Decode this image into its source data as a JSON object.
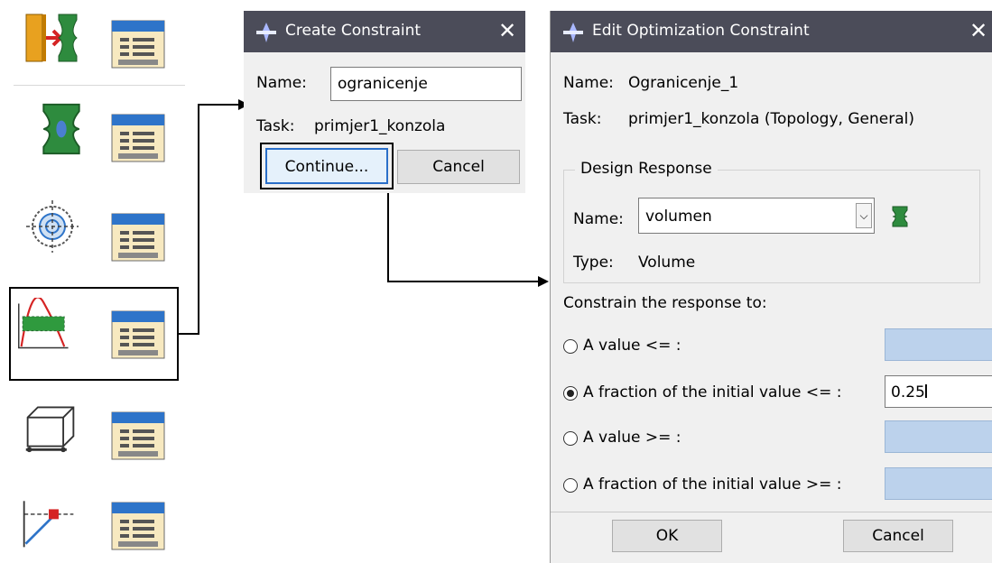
{
  "toolbox": {
    "tools": [
      {
        "name": "create-design-response"
      },
      {
        "name": "create-objective-function"
      },
      {
        "name": "create-constraint"
      },
      {
        "name": "create-geometric-restriction"
      },
      {
        "name": "create-stop-condition"
      }
    ]
  },
  "create_dialog": {
    "title": "Create Constraint",
    "close": "✕",
    "name_label": "Name:",
    "name_value": "ogranicenje",
    "task_label": "Task:",
    "task_value": "primjer1_konzola",
    "continue_label": "Continue...",
    "cancel_label": "Cancel"
  },
  "edit_dialog": {
    "title": "Edit Optimization Constraint",
    "close": "✕",
    "name_label": "Name:",
    "name_value": "Ogranicenje_1",
    "task_label": "Task:",
    "task_value": "primjer1_konzola (Topology, General)",
    "design_response": {
      "title": "Design Response",
      "name_label": "Name:",
      "name_value": "volumen",
      "type_label": "Type:",
      "type_value": "Volume"
    },
    "constrain_label": "Constrain the response to:",
    "options": [
      {
        "label": "A value <= :",
        "selected": false,
        "value": ""
      },
      {
        "label": "A fraction of the initial value <= :",
        "selected": true,
        "value": "0.25"
      },
      {
        "label": "A value >= :",
        "selected": false,
        "value": ""
      },
      {
        "label": "A fraction of the initial value >= :",
        "selected": false,
        "value": ""
      }
    ],
    "ok_label": "OK",
    "cancel_label": "Cancel"
  },
  "colors": {
    "titlebar": "#4b4c59",
    "dialog_bg": "#f0f0f0",
    "disabled_field": "#bcd2ec",
    "accent_blue": "#2a6fc9"
  }
}
